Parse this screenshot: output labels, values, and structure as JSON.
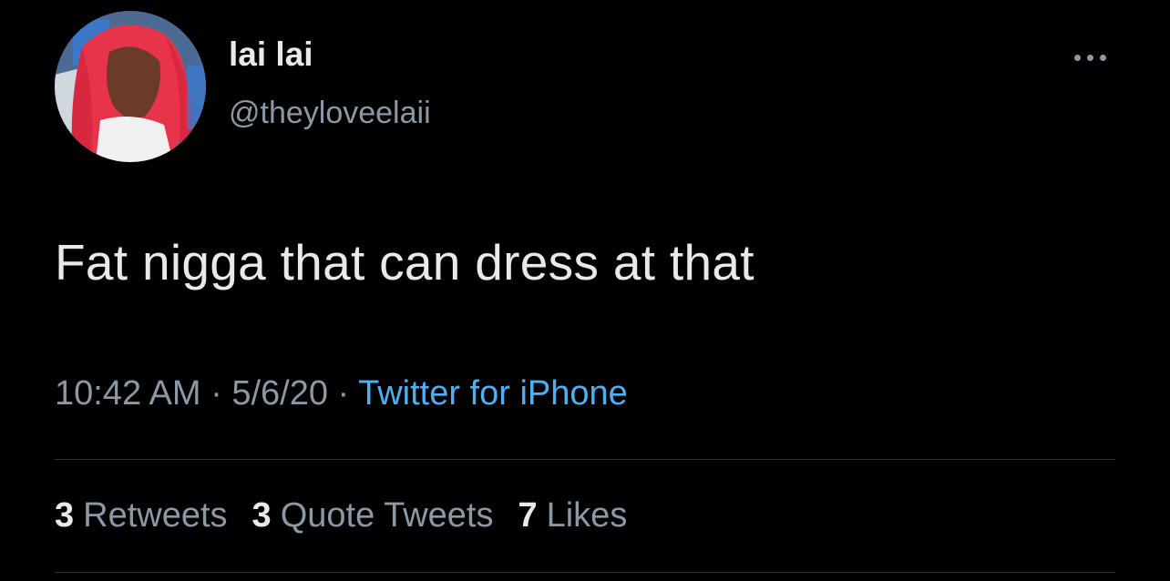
{
  "author": {
    "display_name": "lai lai",
    "handle": "@theyloveelaii"
  },
  "tweet": {
    "text": "Fat nigga that can dress at that"
  },
  "meta": {
    "time": "10:42 AM",
    "separator1": " · ",
    "date": "5/6/20",
    "separator2": " · ",
    "source": "Twitter for iPhone"
  },
  "stats": {
    "retweets": {
      "count": "3",
      "label": "Retweets"
    },
    "quote_tweets": {
      "count": "3",
      "label": "Quote Tweets"
    },
    "likes": {
      "count": "7",
      "label": "Likes"
    }
  },
  "icons": {
    "more": "more-options-icon"
  },
  "colors": {
    "background": "#000000",
    "primary_text": "#e7e9ea",
    "secondary_text": "#8b98a5",
    "link": "#4cb0f2",
    "divider": "#2f3336"
  }
}
